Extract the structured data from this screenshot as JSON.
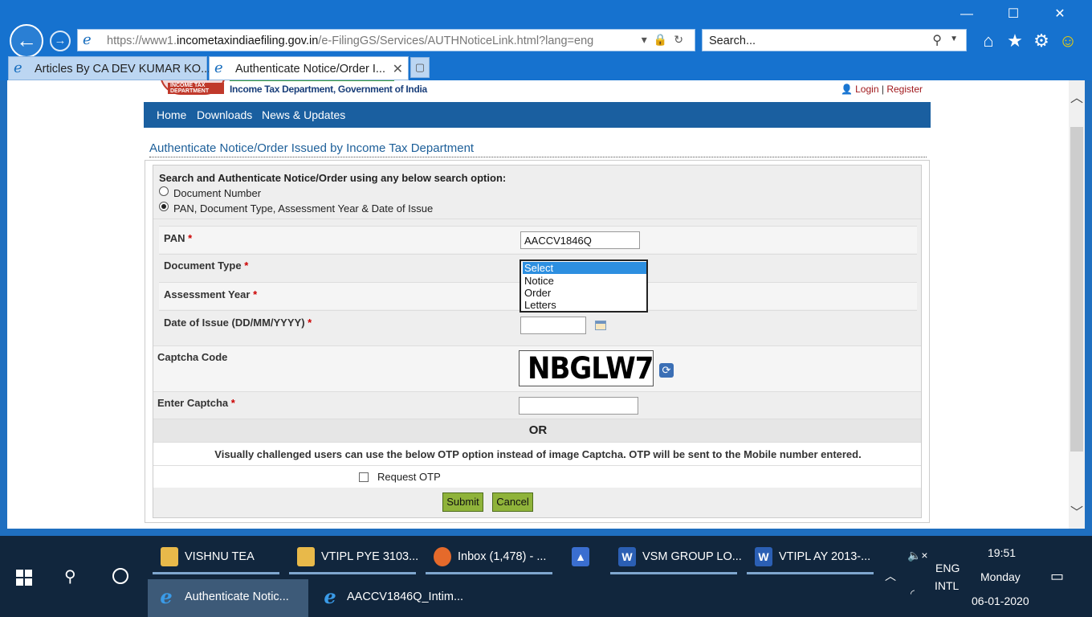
{
  "browser": {
    "window_controls": {
      "minimize": "—",
      "maximize": "☐",
      "close": "✕"
    },
    "address": {
      "prefix": "https://www1.",
      "domain": "incometaxindiaefiling.gov.in",
      "path": "/e-FilingGS/Services/AUTHNoticeLink.html?lang=eng"
    },
    "search_placeholder": "Search...",
    "tabs": [
      {
        "label": "Articles By CA DEV KUMAR KO...",
        "active": false
      },
      {
        "label": "Authenticate Notice/Order I...",
        "active": true
      }
    ]
  },
  "site": {
    "logo_badge": "INCOME TAX DEPARTMENT",
    "logo_text": "Income Tax Department, Government of India",
    "login": "Login",
    "separator": "|",
    "register": "Register",
    "nav": [
      "Home",
      "Downloads",
      "News & Updates"
    ]
  },
  "form": {
    "heading": "Authenticate Notice/Order Issued by Income Tax Department",
    "search_title": "Search and Authenticate Notice/Order using any below search option:",
    "options": [
      {
        "label": "Document Number",
        "selected": false
      },
      {
        "label": "PAN, Document Type, Assessment Year & Date of Issue",
        "selected": true
      }
    ],
    "required_mark": "*",
    "pan_label": "PAN",
    "pan_value": "AACCV1846Q",
    "doc_type_label": "Document Type",
    "doc_type_options": [
      "Select",
      "Notice",
      "Order",
      "Letters"
    ],
    "doc_type_selected": "Select",
    "ay_label": "Assessment Year",
    "date_label": "Date of Issue (DD/MM/YYYY)",
    "captcha_label": "Captcha Code",
    "captcha_text": "NBGLW7",
    "enter_captcha_label": "Enter Captcha",
    "or_text": "OR",
    "otp_note": "Visually challenged users can use the below OTP option instead of image Captcha. OTP will be sent to the Mobile number entered.",
    "request_otp": "Request OTP",
    "submit": "Submit",
    "cancel": "Cancel"
  },
  "taskbar": {
    "row1": [
      {
        "label": "VISHNU TEA",
        "icon": "folder-icon"
      },
      {
        "label": "VTIPL PYE 3103...",
        "icon": "folder-icon"
      },
      {
        "label": "Inbox (1,478) - ...",
        "icon": "firefox-icon"
      },
      {
        "label": "",
        "icon": "app-icon"
      },
      {
        "label": "VSM GROUP LO...",
        "icon": "word-icon"
      },
      {
        "label": "VTIPL AY 2013-...",
        "icon": "word-icon"
      }
    ],
    "row2": [
      {
        "label": "Authenticate Notic...",
        "icon": "ie-icon"
      },
      {
        "label": "AACCV1846Q_Intim...",
        "icon": "ie-icon"
      }
    ],
    "lang1": "ENG",
    "lang2": "INTL",
    "time": "19:51",
    "day": "Monday",
    "date": "06-01-2020"
  },
  "colors": {
    "chrome": "#1672cf",
    "nav": "#1a5fa0",
    "button": "#8fb33a",
    "taskbar": "#11263d"
  }
}
